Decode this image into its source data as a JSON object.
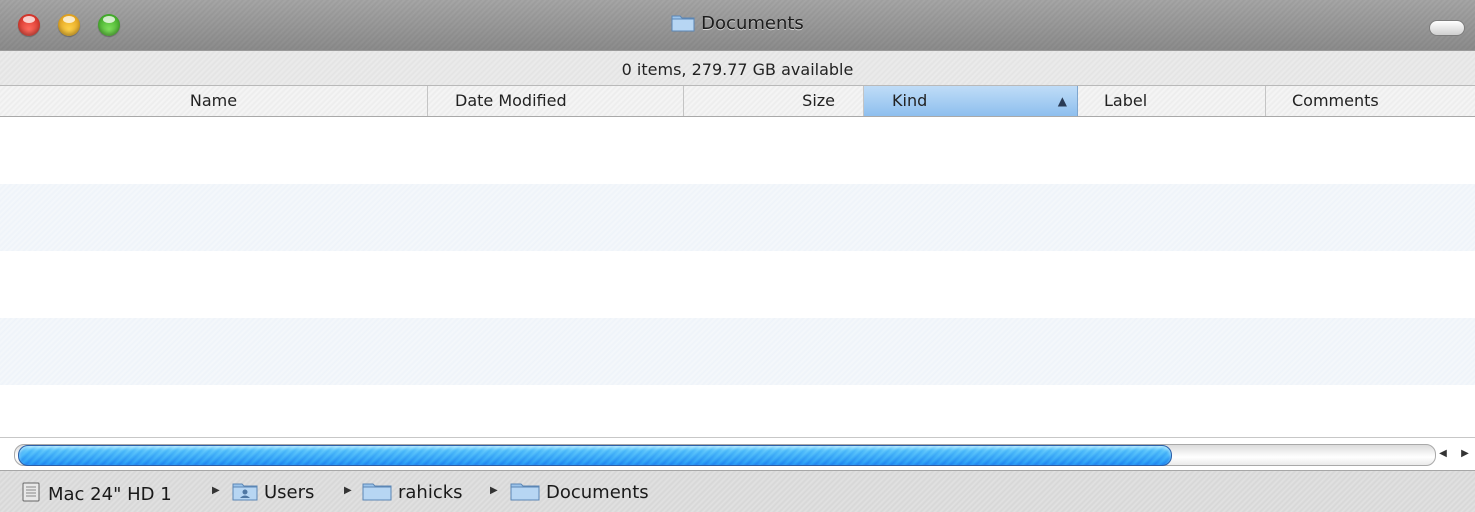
{
  "window": {
    "title": "Documents",
    "title_icon": "folder-icon"
  },
  "status": {
    "text": "0 items, 279.77 GB available"
  },
  "columns": {
    "name": "Name",
    "date_modified": "Date Modified",
    "size": "Size",
    "kind": "Kind",
    "label": "Label",
    "comments": "Comments",
    "sorted_by": "Kind",
    "sort_icon": "sort-ascending-icon"
  },
  "path": [
    {
      "label": "Mac 24\" HD 1",
      "icon": "hard-drive-icon"
    },
    {
      "label": "Users",
      "icon": "users-folder-icon"
    },
    {
      "label": "rahicks",
      "icon": "folder-icon"
    },
    {
      "label": "Documents",
      "icon": "folder-icon"
    }
  ],
  "colors": {
    "accent": "#8ebfee",
    "scroll_thumb": "#4f8ed9"
  }
}
